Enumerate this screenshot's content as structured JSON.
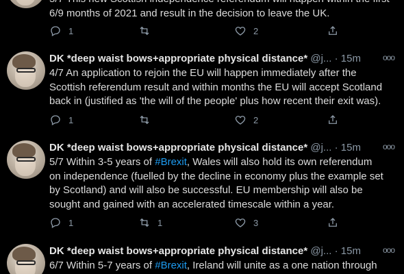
{
  "tweets": [
    {
      "name": "",
      "handle": "",
      "time": "",
      "text_lines": [
        "5/7 This new Scottish independence referendum will happen within the first",
        "6/9 months of 2021 and result in the decision to leave the UK."
      ],
      "replies": "1",
      "retweets": "",
      "likes": "2"
    },
    {
      "name": "DK *deep waist bows+appropriate physical distance*",
      "handle": "@j...",
      "time": "· 15m",
      "text_lines": [
        "4/7 An application to rejoin the EU will happen immediately after the",
        "Scottish referendum result and within months the EU will accept Scotland",
        "back in (justified as 'the will of the people' plus how recent their exit was)."
      ],
      "replies": "1",
      "retweets": "",
      "likes": "2"
    },
    {
      "name": "DK *deep waist bows+appropriate physical distance*",
      "handle": "@j...",
      "time": "· 15m",
      "text_lines_pre": "5/7 Within 3-5 years of ",
      "hashtag": "#Brexit",
      "text_lines_post": ", Wales will also hold its own referendum",
      "text_lines": [
        "on independence (fuelled by the decline in economy plus the example set",
        "by Scotland) and will also be successful. EU membership will also be",
        "sought and gained with an accelerated timescale within a year."
      ],
      "replies": "1",
      "retweets": "1",
      "likes": "3"
    },
    {
      "name": "DK *deep waist bows+appropriate physical distance*",
      "handle": "@j...",
      "time": "· 15m",
      "text_lines_pre": "6/7 Within 5-7 years of ",
      "hashtag": "#Brexit",
      "text_lines_post": ", Ireland will unite as a one nation through",
      "text_lines": [],
      "replies": "",
      "retweets": "",
      "likes": ""
    }
  ],
  "more_glyph": "ooo",
  "colors": {
    "background": "#000000",
    "hashtag": "#1d9bf0",
    "muted": "#8b98a5"
  }
}
